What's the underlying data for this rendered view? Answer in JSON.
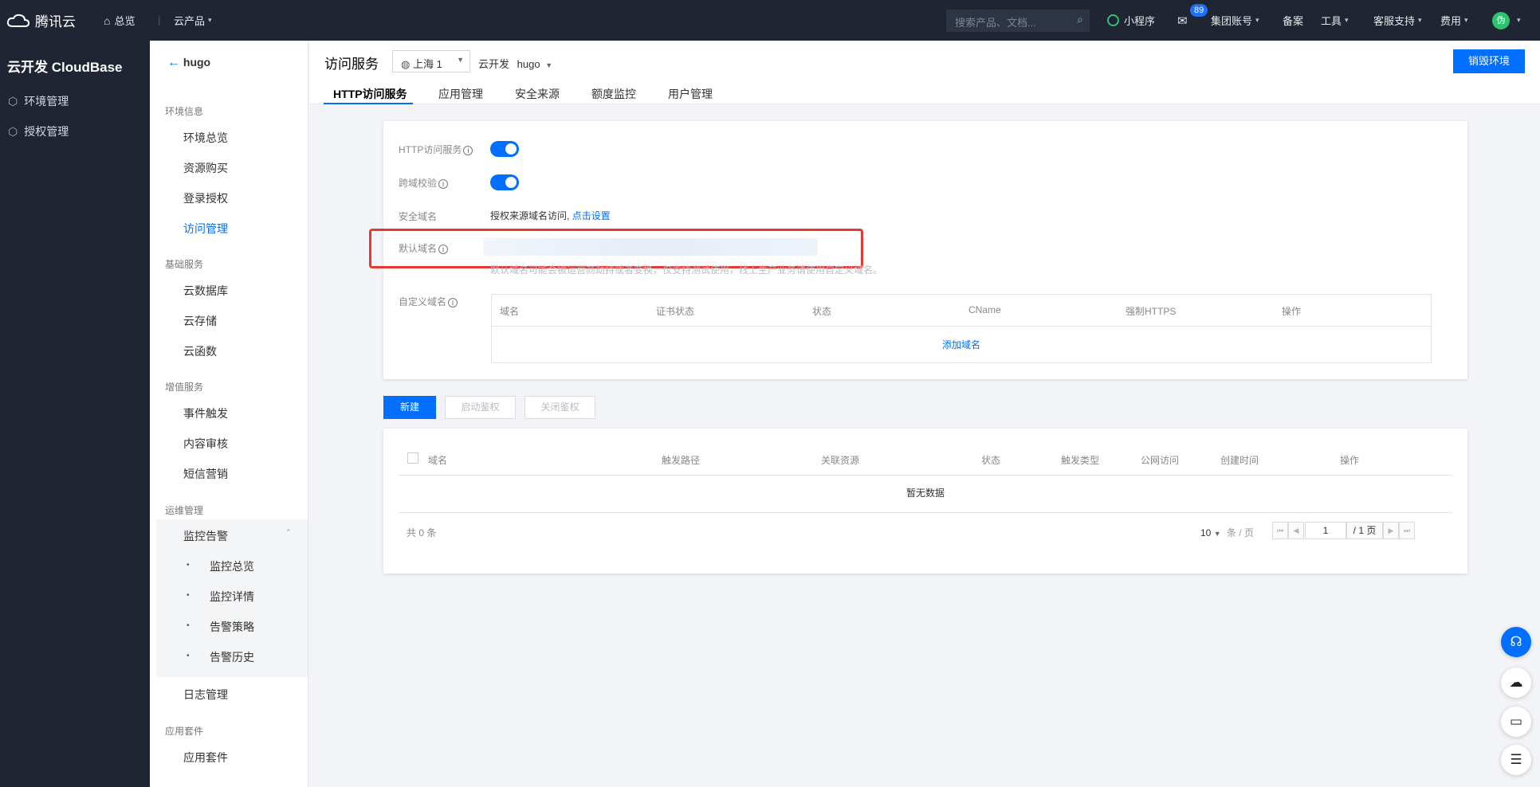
{
  "topbar": {
    "logo": "腾讯云",
    "overview": "总览",
    "products": "云产品",
    "search_placeholder": "搜索产品、文档...",
    "miniprogram": "小程序",
    "mail_badge": "89",
    "group_account": "集团账号",
    "filing": "备案",
    "tools": "工具",
    "support": "客服支持",
    "billing": "费用",
    "avatar": "伪"
  },
  "sidebar": {
    "brand": "云开发 CloudBase",
    "items": [
      {
        "label": "环境管理",
        "icon": "environment-icon"
      },
      {
        "label": "授权管理",
        "icon": "authorization-icon"
      }
    ]
  },
  "env_nav": {
    "back_label": "hugo",
    "groups": {
      "env_info": "环境信息",
      "basic": "基础服务",
      "value_added": "增值服务",
      "ops": "运维管理",
      "suite": "应用套件"
    },
    "items": {
      "overview": "环境总览",
      "purchase": "资源购买",
      "login_auth": "登录授权",
      "access_mgmt": "访问管理",
      "database": "云数据库",
      "storage": "云存储",
      "functions": "云函数",
      "event_trigger": "事件触发",
      "content_review": "内容审核",
      "sms_marketing": "短信营销",
      "monitor_alert": "监控告警",
      "monitor_overview": "监控总览",
      "monitor_detail": "监控详情",
      "alert_policy": "告警策略",
      "alert_history": "告警历史",
      "log_mgmt": "日志管理",
      "app_suite": "应用套件"
    }
  },
  "header": {
    "title": "访问服务",
    "region": "上海 1",
    "env_prefix": "云开发",
    "env_name": "hugo",
    "destroy_button": "销毁环境",
    "tabs": [
      "HTTP访问服务",
      "应用管理",
      "安全来源",
      "额度监控",
      "用户管理"
    ]
  },
  "settings": {
    "http_service_label": "HTTP访问服务",
    "http_service_enabled": true,
    "cors_label": "跨域校验",
    "cors_enabled": true,
    "safe_domain_label": "安全域名",
    "safe_domain_text": "授权来源域名访问,",
    "safe_domain_link": "点击设置",
    "default_domain_label": "默认域名",
    "default_domain_note": "默认域名可能会被运营商劫持或者变换，仅支持测试使用，线上生产业务请使用自定义域名。",
    "custom_domain_label": "自定义域名",
    "custom_domain_columns": [
      "域名",
      "证书状态",
      "状态",
      "CName",
      "强制HTTPS",
      "操作"
    ],
    "add_domain": "添加域名"
  },
  "routes": {
    "new_button": "新建",
    "enable_auth_button": "启动鉴权",
    "disable_auth_button": "关闭鉴权",
    "columns": [
      "域名",
      "触发路径",
      "关联资源",
      "状态",
      "触发类型",
      "公网访问",
      "创建时间",
      "操作"
    ],
    "empty": "暂无数据",
    "total": "共 0 条",
    "page_size": "10",
    "per_page_unit": "条 / 页",
    "page_current": "1",
    "page_total": "/ 1 页"
  },
  "float_buttons": [
    "support-icon",
    "cloud-icon",
    "book-icon",
    "list-icon"
  ],
  "colors": {
    "accent": "#006eff",
    "topbar": "#1f2532",
    "highlight": "#e53935"
  }
}
